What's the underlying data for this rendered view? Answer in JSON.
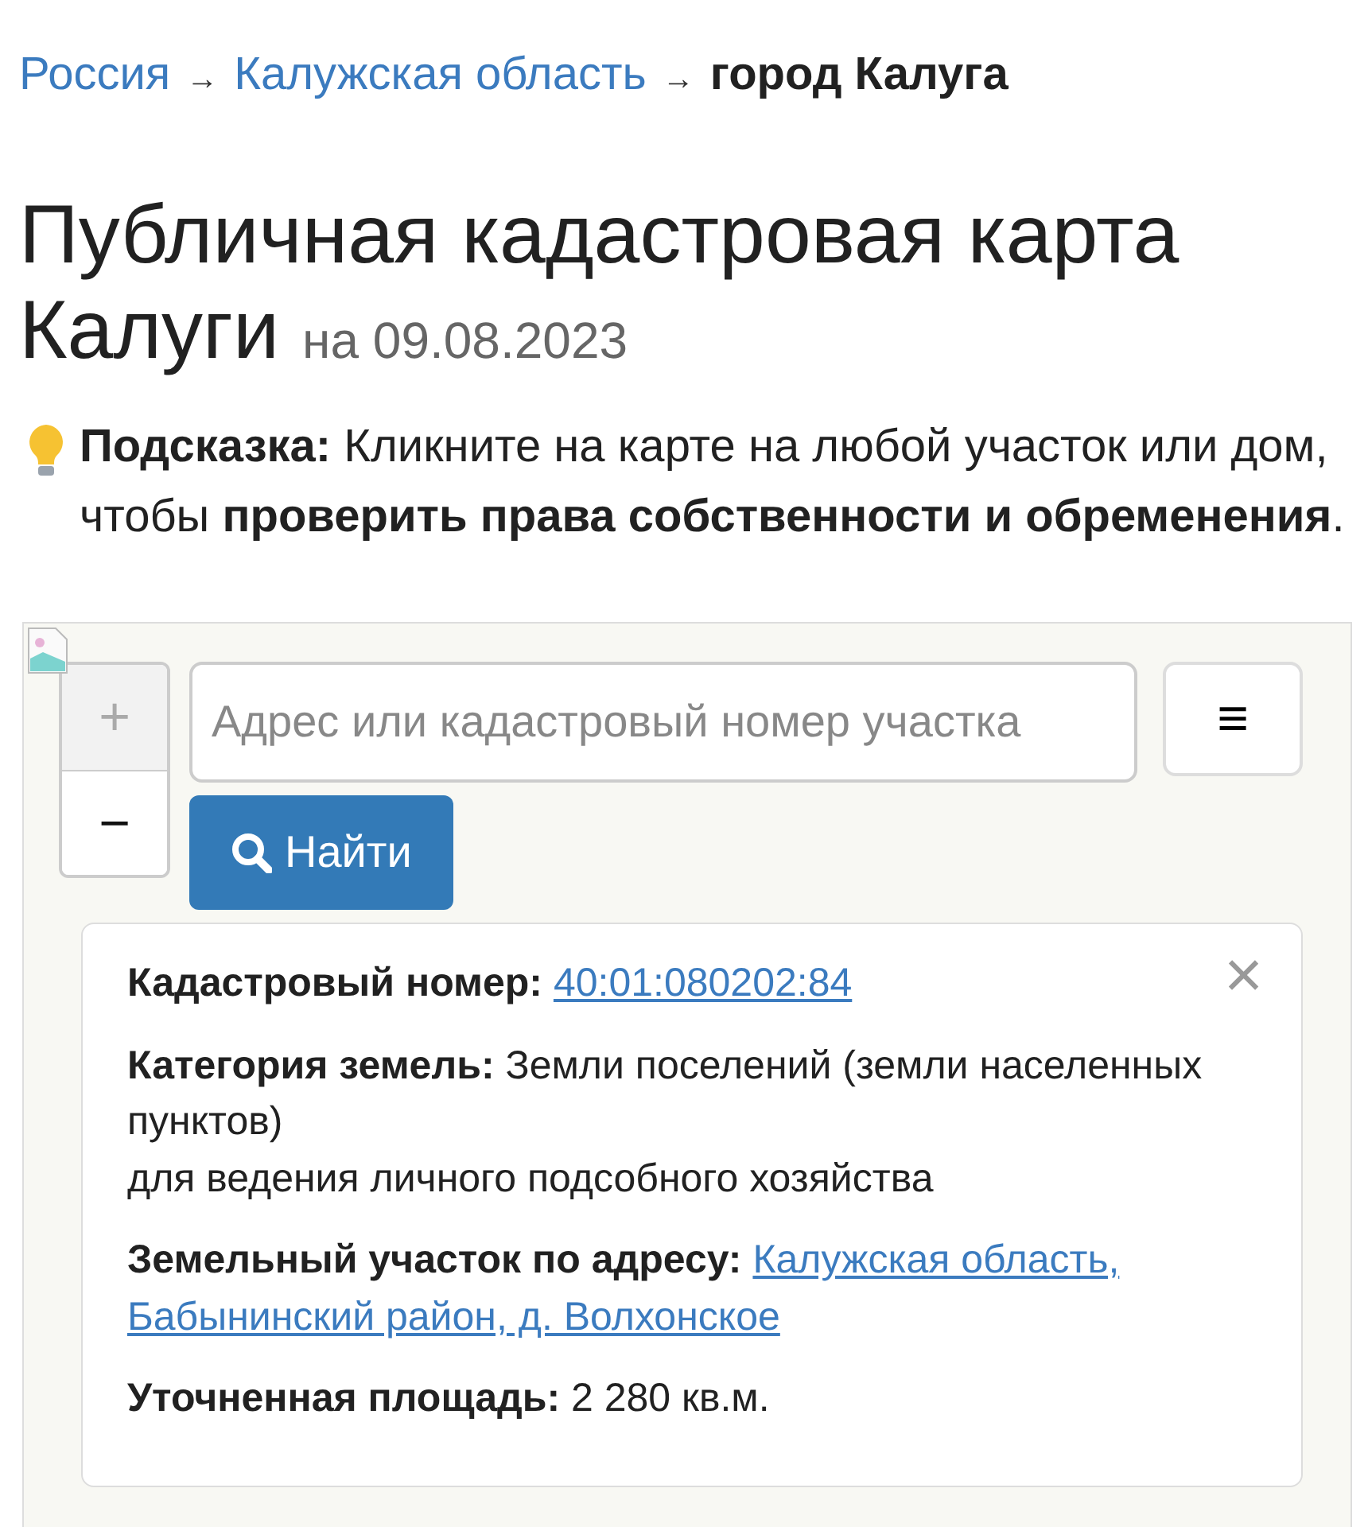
{
  "breadcrumb": {
    "items": [
      {
        "text": "Россия",
        "kind": "link"
      },
      {
        "text": "Калужская область",
        "kind": "link"
      },
      {
        "text": "город Калуга",
        "kind": "current"
      }
    ],
    "separators": [
      "→",
      "→"
    ]
  },
  "title": {
    "lines": [
      "Публичная кадастровая карта",
      "Калуги"
    ],
    "date": "на 09.08.2023"
  },
  "hint": "**Подсказка:** Кликните на карте на любой участок или дом, чтобы **проверить права собственности и обременения**.",
  "map": {
    "zoom_in": "+",
    "zoom_out": "−",
    "zoom_in_disabled": true,
    "search": {
      "placeholder": "Адрес или кадастровый номер участка"
    },
    "menu_button": "≡",
    "find_button": "Найти",
    "popup": {
      "close": "×",
      "fields": [
        {
          "label": "Кадастровый номер:",
          "link": "40:01:080202:84"
        },
        {
          "label": "Категория земель:",
          "text": "Земли поселений (земли населенных пунктов)",
          "note": "для ведения личного подсобного хозяйства"
        },
        {
          "label": "Земельный участок по адресу:",
          "link_lines": [
            "Калужская область,",
            "Бабынинский район, д. Волхонское"
          ]
        },
        {
          "label": "Уточненная площадь:",
          "text": "2 280 кв.м."
        }
      ]
    }
  }
}
